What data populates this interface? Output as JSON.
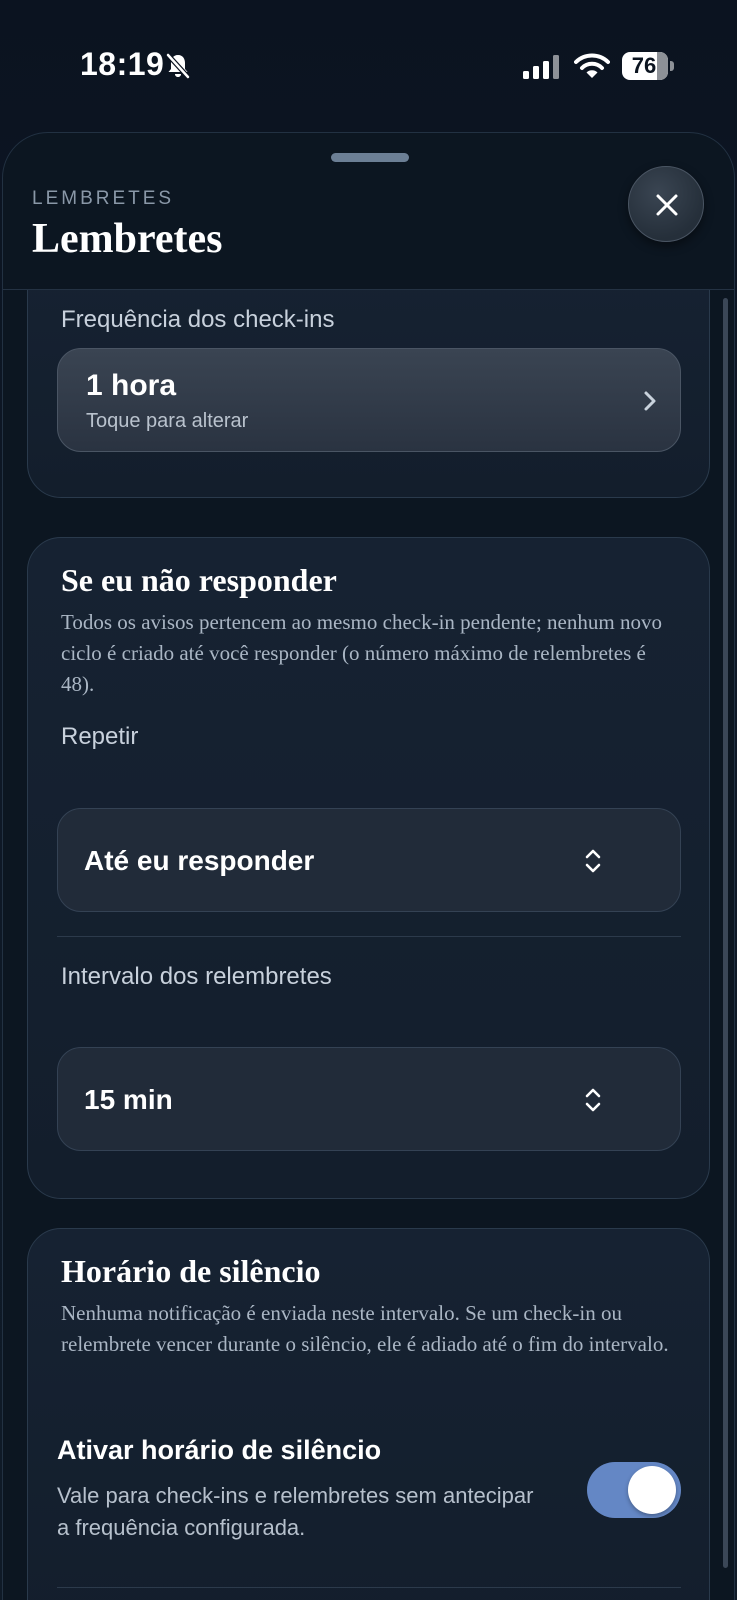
{
  "status_bar": {
    "time": "18:19",
    "battery": "76",
    "icons": [
      "bell-slash-icon",
      "cellular-signal-icon",
      "wifi-icon",
      "battery-icon"
    ]
  },
  "sheet": {
    "eyebrow": "LEMBRETES",
    "title": "Lembretes",
    "close_icon": "close-icon"
  },
  "frequency": {
    "label": "Frequência dos check-ins",
    "value": "1 hora",
    "hint": "Toque para alterar"
  },
  "no_response": {
    "title": "Se eu não responder",
    "description": "Todos os avisos pertencem ao mesmo check-in pendente; nenhum novo ciclo é criado até você responder (o número máximo de relembretes é 48).",
    "repeat_label": "Repetir",
    "repeat_value": "Até eu responder",
    "interval_label": "Intervalo dos relembretes",
    "interval_value": "15 min"
  },
  "silence": {
    "title": "Horário de silêncio",
    "description": "Nenhuma notificação é enviada neste intervalo. Se um check-in ou relembrete vencer durante o silêncio, ele é adiado até o fim do intervalo.",
    "toggle_title": "Ativar horário de silêncio",
    "toggle_description": "Vale para check-ins e relembretes sem antecipar a frequência configurada.",
    "toggle_on": true
  },
  "colors": {
    "background": "#0b1420",
    "toggle_on": "#6487c5"
  }
}
